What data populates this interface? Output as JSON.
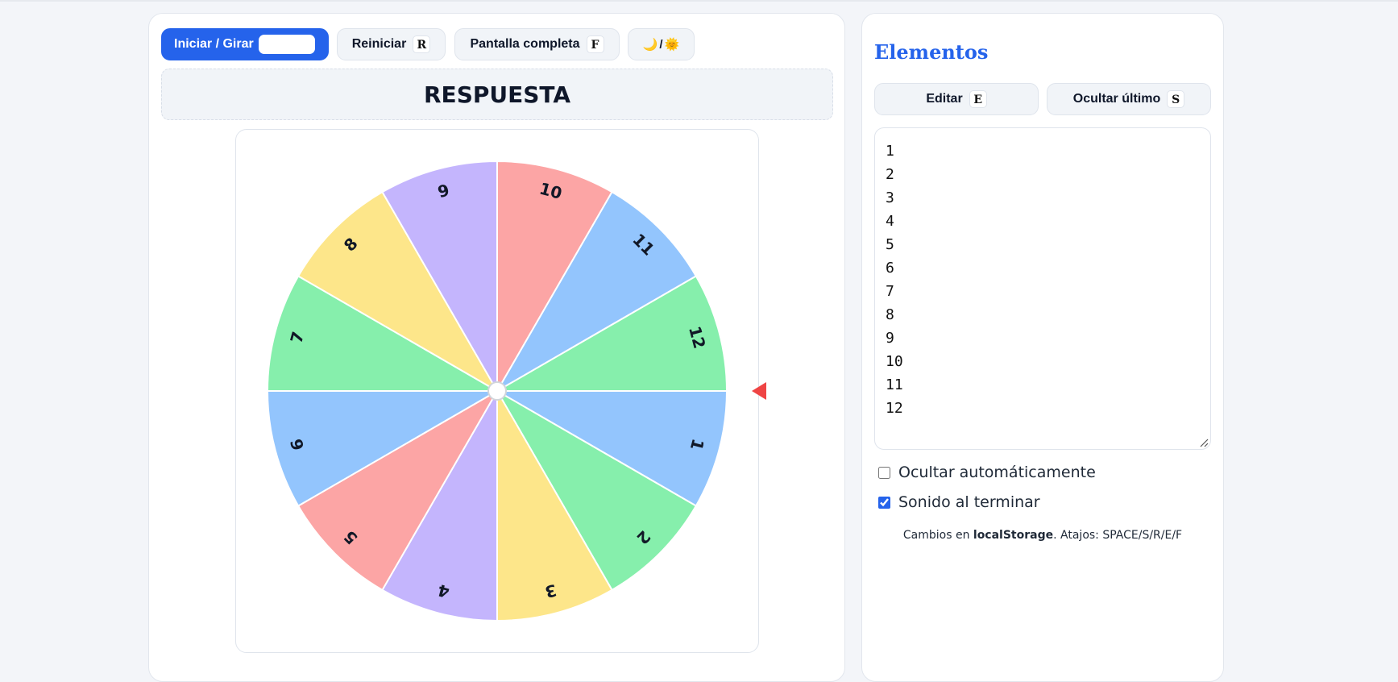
{
  "toolbar": {
    "spin_label": "Iniciar / Girar",
    "reset_label": "Reiniciar",
    "reset_key": "R",
    "fullscreen_label": "Pantalla completa",
    "fullscreen_key": "F",
    "theme_moon": "🌙",
    "theme_sep": "/",
    "theme_sun": "🌞"
  },
  "answer": {
    "text": "RESPUESTA"
  },
  "wheel": {
    "segments": [
      {
        "label": "10",
        "color": "#fca5a5"
      },
      {
        "label": "11",
        "color": "#93c5fd"
      },
      {
        "label": "12",
        "color": "#86efac"
      },
      {
        "label": "1",
        "color": "#93c5fd"
      },
      {
        "label": "2",
        "color": "#86efac"
      },
      {
        "label": "3",
        "color": "#fde68a"
      },
      {
        "label": "4",
        "color": "#c4b5fd"
      },
      {
        "label": "5",
        "color": "#fca5a5"
      },
      {
        "label": "6",
        "color": "#93c5fd"
      },
      {
        "label": "7",
        "color": "#86efac"
      },
      {
        "label": "8",
        "color": "#fde68a"
      },
      {
        "label": "9",
        "color": "#c4b5fd"
      }
    ],
    "pointer_color": "#ef4444"
  },
  "sidebar": {
    "title": "Elementos",
    "edit_label": "Editar",
    "edit_key": "E",
    "hide_last_label": "Ocultar último",
    "hide_last_key": "S",
    "items_text": "1\n2\n3\n4\n5\n6\n7\n8\n9\n10\n11\n12",
    "auto_hide_label": "Ocultar automáticamente",
    "auto_hide_checked": false,
    "sound_label": "Sonido al terminar",
    "sound_checked": true,
    "note_prefix": "Cambios en ",
    "note_storage": "localStorage",
    "note_suffix": ". Atajos: SPACE/S/R/E/F"
  },
  "colors": {
    "accent": "#2563eb",
    "pointer": "#ef4444"
  }
}
